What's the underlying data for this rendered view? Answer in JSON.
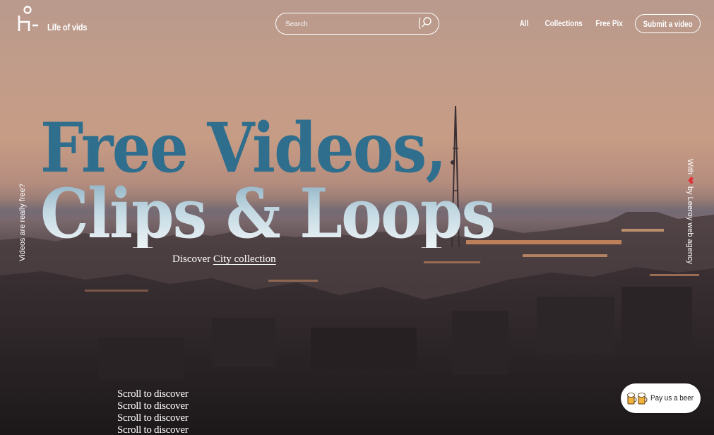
{
  "header": {
    "brand": "Life of vids",
    "search": {
      "placeholder": "Search"
    },
    "nav": [
      "All",
      "Collections",
      "Free Pix"
    ],
    "submit_label": "Submit a video"
  },
  "hero": {
    "line1": "Free Videos,",
    "line2": "Clips & Loops",
    "discover_prefix": "Discover ",
    "discover_link": "City",
    "discover_suffix": " collection"
  },
  "side": {
    "left_text": "Videos are really free?",
    "right_prefix": "With",
    "right_suffix": "by Leeroy web agency"
  },
  "scroll_lines": [
    "Scroll to discover",
    "Scroll to discover",
    "Scroll to discover",
    "Scroll to discover"
  ],
  "beer_button": {
    "label": "Pay us a beer",
    "icon": "beer-mug-icon"
  },
  "colors": {
    "hero_line1": "#2f6e8d",
    "hero_line2": "#c2d8e2",
    "sky_top": "#b99a8d",
    "ground": "#1f1b1d"
  }
}
